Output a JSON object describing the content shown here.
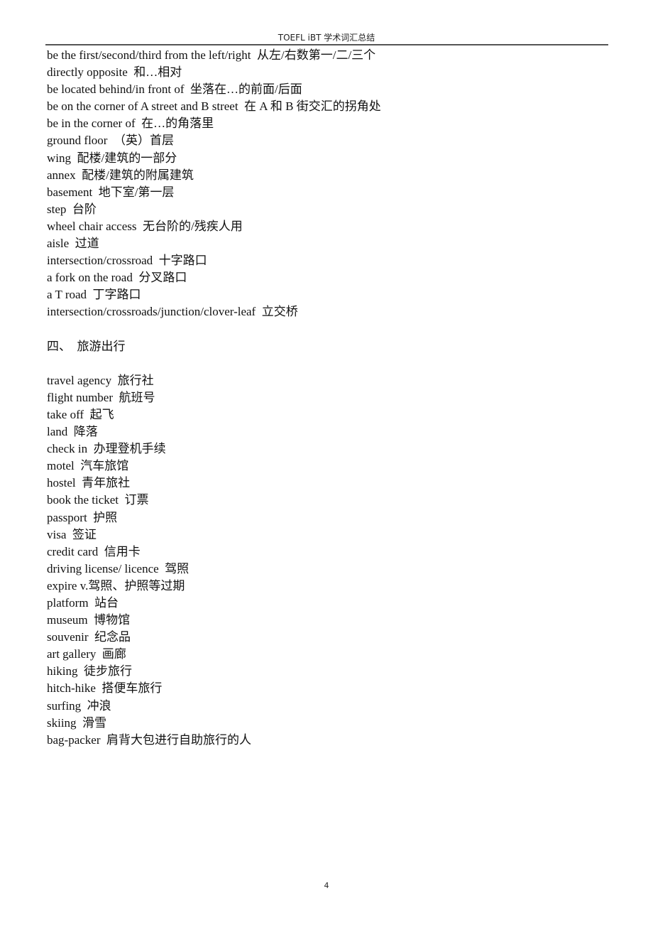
{
  "header": {
    "title": "TOEFL iBT  学术词汇总结"
  },
  "section_locations": {
    "entries": [
      "be the first/second/third from the left/right  从左/右数第一/二/三个",
      "directly opposite  和…相对",
      "be located behind/in front of  坐落在…的前面/后面",
      "be on the corner of A street and B street  在 A 和 B 街交汇的拐角处",
      "be in the corner of  在…的角落里",
      "ground floor  （英）首层",
      "wing  配楼/建筑的一部分",
      "annex  配楼/建筑的附属建筑",
      "basement  地下室/第一层",
      "step  台阶",
      "wheel chair access  无台阶的/残疾人用",
      "aisle  过道",
      "intersection/crossroad  十字路口",
      "a fork on the road  分叉路口",
      "a T road  丁字路口",
      "intersection/crossroads/junction/clover-leaf  立交桥"
    ]
  },
  "section_travel": {
    "heading": "四、  旅游出行",
    "entries": [
      "travel agency  旅行社",
      "flight number  航班号",
      "take off  起飞",
      "land  降落",
      "check in  办理登机手续",
      "motel  汽车旅馆",
      "hostel  青年旅社",
      "book the ticket  订票",
      "passport  护照",
      "visa  签证",
      "credit card  信用卡",
      "driving license/ licence  驾照",
      "expire v.驾照、护照等过期",
      "platform  站台",
      "museum  博物馆",
      "souvenir  纪念品",
      "art gallery  画廊",
      "hiking  徒步旅行",
      "hitch-hike  搭便车旅行",
      "surfing  冲浪",
      "skiing  滑雪",
      "bag-packer  肩背大包进行自助旅行的人"
    ]
  },
  "footer": {
    "page_number": "4"
  }
}
